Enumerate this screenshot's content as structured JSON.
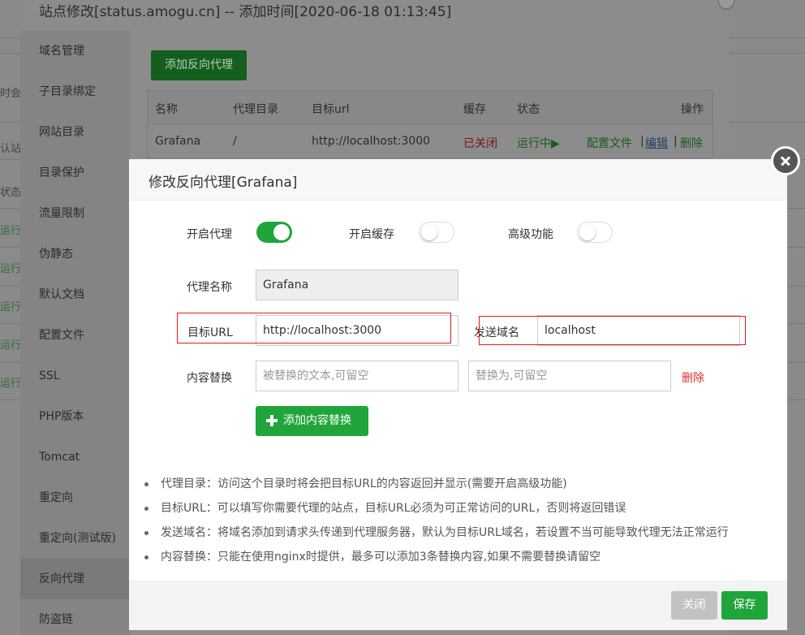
{
  "site_dialog": {
    "title": "站点修改[status.amogu.cn] -- 添加时间[2020-06-18 01:13:45]",
    "nav": [
      "域名管理",
      "子目录绑定",
      "网站目录",
      "目录保护",
      "流量限制",
      "伪静态",
      "默认文档",
      "配置文件",
      "SSL",
      "PHP版本",
      "Tomcat",
      "重定向",
      "重定向(测试版)",
      "反向代理",
      "防盗链"
    ],
    "active_nav": "反向代理",
    "add_proxy_label": "添加反向代理",
    "table": {
      "headers": [
        "名称",
        "代理目录",
        "目标url",
        "缓存",
        "状态",
        "操作"
      ],
      "row": {
        "name": "Grafana",
        "dir": "/",
        "url": "http://localhost:3000",
        "cache": "已关闭",
        "status": "运行中▶",
        "action_config": "配置文件",
        "sep": "|",
        "action_edit": "编辑",
        "action_delete": "删除"
      }
    }
  },
  "background_rows": [
    "时会",
    "认站",
    "状态",
    "运行",
    "运行",
    "运行",
    "运行",
    "运行"
  ],
  "modal": {
    "title": "修改反向代理[Grafana]",
    "enable_proxy_label": "开启代理",
    "enable_proxy_on": true,
    "enable_cache_label": "开启缓存",
    "enable_cache_on": false,
    "advanced_label": "高级功能",
    "advanced_on": false,
    "proxy_name_label": "代理名称",
    "proxy_name_value": "Grafana",
    "target_url_label": "目标URL",
    "target_url_value": "http://localhost:3000",
    "send_domain_label": "发送域名",
    "send_domain_value": "localhost",
    "content_replace_label": "内容替换",
    "replace_from_placeholder": "被替换的文本,可留空",
    "replace_to_placeholder": "替换为,可留空",
    "delete_label": "删除",
    "add_replace_label": "添加内容替换",
    "tips": [
      "代理目录：访问这个目录时将会把目标URL的内容返回并显示(需要开启高级功能)",
      "目标URL：可以填写你需要代理的站点，目标URL必须为可正常访问的URL，否则将返回错误",
      "发送域名：将域名添加到请求头传递到代理服务器，默认为目标URL域名，若设置不当可能导致代理无法正常运行",
      "内容替换：只能在使用nginx时提供，最多可以添加3条替换内容,如果不需要替换请留空"
    ],
    "close_label": "关闭",
    "save_label": "保存"
  },
  "colors": {
    "accent": "#20a53a",
    "danger": "#d9302c",
    "highlight_box": "#e21a1a"
  }
}
